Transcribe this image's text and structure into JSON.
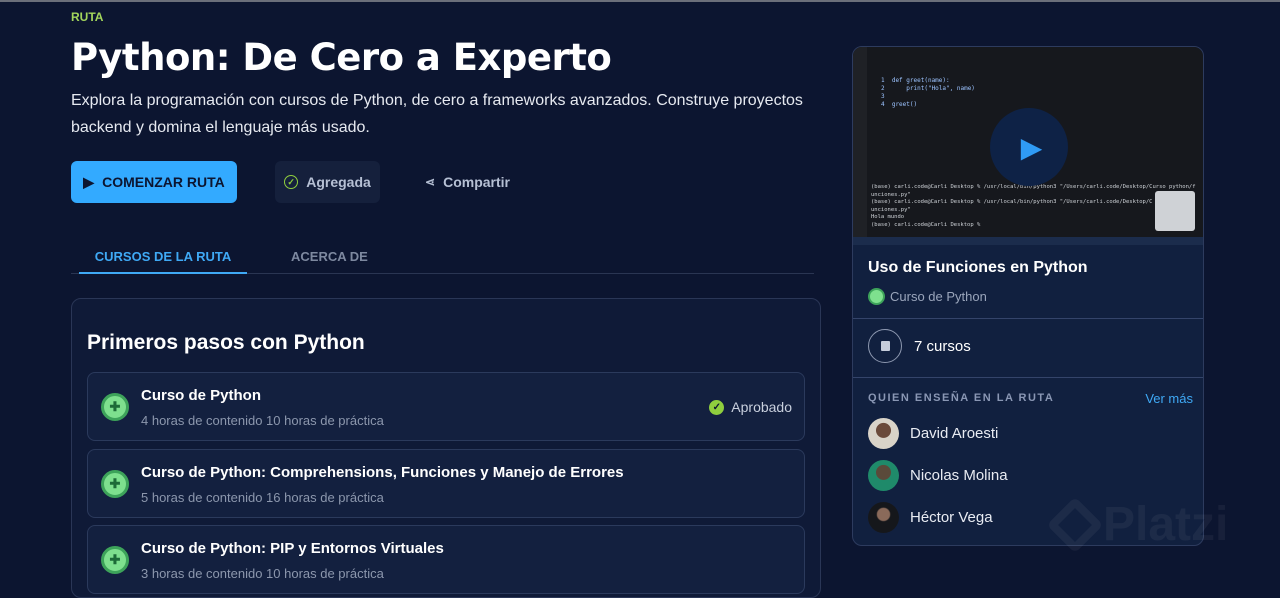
{
  "header": {
    "eyebrow": "RUTA",
    "title": "Python: De Cero a Experto",
    "description": "Explora la programación con cursos de Python, de cero a frameworks avanzados. Construye proyectos backend y domina el lenguaje más usado."
  },
  "actions": {
    "start": "COMENZAR RUTA",
    "added": "Agregada",
    "share": "Compartir"
  },
  "tabs": [
    "CURSOS DE LA RUTA",
    "ACERCA DE"
  ],
  "section": {
    "title": "Primeros pasos con Python",
    "courses": [
      {
        "title": "Curso de Python",
        "meta": "4 horas de contenido 10 horas de práctica",
        "status": "Aprobado"
      },
      {
        "title": "Curso de Python: Comprehensions, Funciones y Manejo de Errores",
        "meta": "5 horas de contenido 16 horas de práctica"
      },
      {
        "title": "Curso de Python: PIP y Entornos Virtuales",
        "meta": "3 horas de contenido 10 horas de práctica"
      }
    ]
  },
  "sidebar": {
    "video_title": "Uso de Funciones en Python",
    "video_course": "Curso de Python",
    "course_count": "7 cursos",
    "teachers_heading": "QUIEN ENSEÑA EN LA RUTA",
    "see_more": "Ver más",
    "teachers": [
      "David Aroesti",
      "Nicolas Molina",
      "Héctor Vega"
    ],
    "code": [
      "1  def greet(name):",
      "2      print(\"Hola\", name)",
      "3",
      "4  greet()"
    ],
    "terminal": [
      "(base) carli.code@Carli Desktop % /usr/local/bin/python3 \"/Users/carli.code/Desktop/Curso python/f",
      "unciones.py\"",
      "(base) carli.code@Carli Desktop % /usr/local/bin/python3 \"/Users/carli.code/Desktop/C",
      "unciones.py\"",
      "Hola mundo",
      "(base) carli.code@Carli Desktop % "
    ]
  },
  "watermark": "Platzi",
  "colors": {
    "accent": "#33aaff",
    "green": "#a3d65c",
    "bg": "#0c1530"
  }
}
